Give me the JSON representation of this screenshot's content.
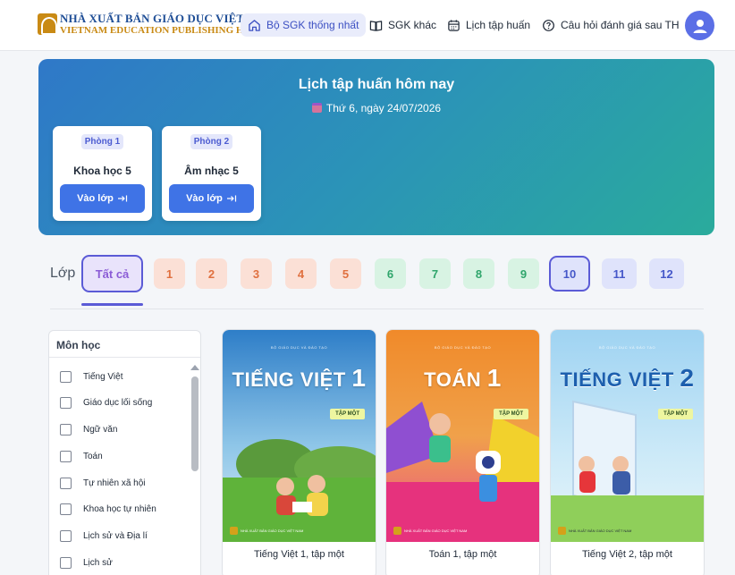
{
  "brand": {
    "line1": "NHÀ XUẤT BẢN GIÁO DỤC VIỆT NAM",
    "line2": "VIETNAM EDUCATION PUBLISHING HOUSE"
  },
  "nav": {
    "items": [
      {
        "label": "Bộ SGK thống nhất",
        "icon": "home-icon",
        "active": true
      },
      {
        "label": "SGK khác",
        "icon": "book-icon",
        "active": false
      },
      {
        "label": "Lịch tập huấn",
        "icon": "calendar-icon",
        "active": false
      },
      {
        "label": "Câu hỏi đánh giá sau TH",
        "icon": "help-circle-icon",
        "active": false
      }
    ]
  },
  "banner": {
    "title": "Lịch tập huấn hôm nay",
    "date": "Thứ 6, ngày 24/07/2026",
    "rooms": [
      {
        "room": "Phòng 1",
        "subject": "Khoa học 5",
        "button": "Vào lớp"
      },
      {
        "room": "Phòng 2",
        "subject": "Âm nhạc 5",
        "button": "Vào lớp"
      }
    ]
  },
  "grade_filter": {
    "label": "Lớp",
    "all_label": "Tất cả",
    "grades": [
      "1",
      "2",
      "3",
      "4",
      "5",
      "6",
      "7",
      "8",
      "9",
      "10",
      "11",
      "12"
    ],
    "selected": [
      "Tất cả",
      "10"
    ]
  },
  "subjects": {
    "heading": "Môn học",
    "items": [
      "Tiếng Việt",
      "Giáo dục lối sống",
      "Ngữ văn",
      "Toán",
      "Tự nhiên xã hội",
      "Khoa học tự nhiên",
      "Lịch sử và Địa lí",
      "Lịch sử"
    ]
  },
  "books": [
    {
      "caption": "Tiếng Việt 1, tập một",
      "cover_title": "TIẾNG VIỆT",
      "cover_num": "1",
      "cover_tag": "TẬP MỘT",
      "cover_top": "BỘ GIÁO DỤC VÀ ĐÀO TẠO",
      "cover_pub": "NHÀ XUẤT BẢN GIÁO DỤC VIỆT NAM"
    },
    {
      "caption": "Toán 1, tập một",
      "cover_title": "TOÁN",
      "cover_num": "1",
      "cover_tag": "TẬP MỘT",
      "cover_top": "BỘ GIÁO DỤC VÀ ĐÀO TẠO",
      "cover_pub": "NHÀ XUẤT BẢN GIÁO DỤC VIỆT NAM"
    },
    {
      "caption": "Tiếng Việt 2, tập một",
      "cover_title": "TIẾNG VIỆT",
      "cover_num": "2",
      "cover_tag": "TẬP MỘT",
      "cover_top": "BỘ GIÁO DỤC VÀ ĐÀO TẠO",
      "cover_pub": "NHÀ XUẤT BẢN GIÁO DỤC VIỆT NAM"
    }
  ],
  "colors": {
    "accent": "#3f73e6",
    "nav_active_bg": "#e9ecfb",
    "primary_grade_bg": "#fbe0d6",
    "middle_grade_bg": "#d8f3e3",
    "high_grade_bg": "#dfe3fb"
  }
}
